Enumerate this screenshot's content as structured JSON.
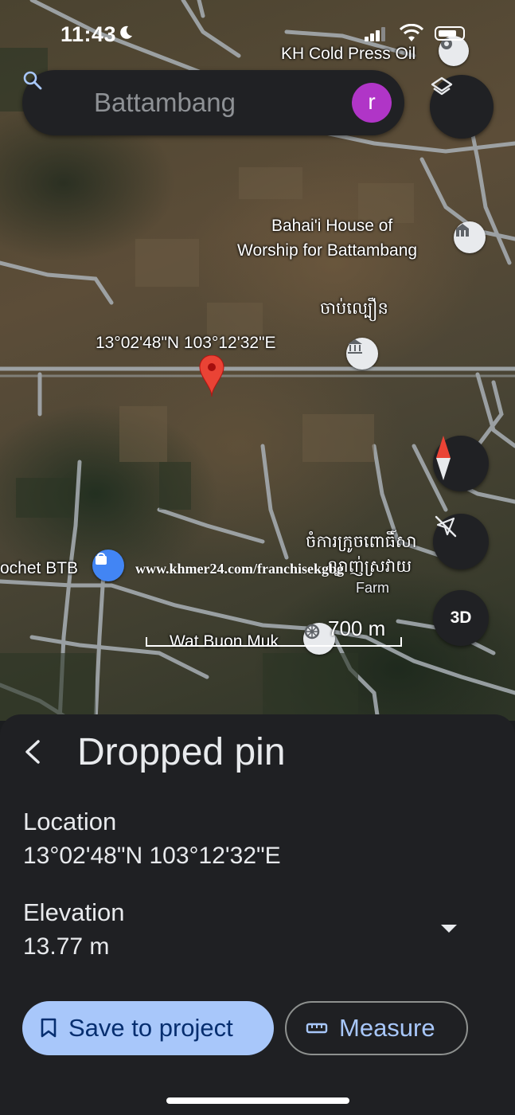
{
  "status_bar": {
    "time": "11:43",
    "icons": [
      "moon-icon",
      "signal-icon",
      "wifi-icon",
      "battery-icon"
    ]
  },
  "search": {
    "placeholder": "Battambang",
    "avatar_letter": "r",
    "avatar_color": "#b035c7"
  },
  "map": {
    "labels": {
      "kh_cold_press": "KH Cold Press Oil",
      "bahai_line1": "Bahai'i House of",
      "bahai_line2": "Worship for Battambang",
      "khmer_place": "ចាប់ល្បឿន",
      "pin_coords": "13°02'48\"N 103°12'32\"E",
      "crochet": "ochet BTB",
      "khmer_farm_line1": "ចំការក្រូចពោធិ៍សា",
      "khmer_farm_line2": "ល្ងាញ់ស្រវាយ",
      "farm": "Farm",
      "wat": "Wat Buon Muk",
      "watermark": "www.khmer24.com/franchisekgbg"
    },
    "scale": "700 m",
    "btn_3d": "3D",
    "pin_color": "#ea4335"
  },
  "sheet": {
    "title": "Dropped pin",
    "location_label": "Location",
    "location_value": "13°02'48\"N 103°12'32\"E",
    "elevation_label": "Elevation",
    "elevation_value": "13.77 m",
    "save_button": "Save to project",
    "measure_button": "Measure"
  }
}
